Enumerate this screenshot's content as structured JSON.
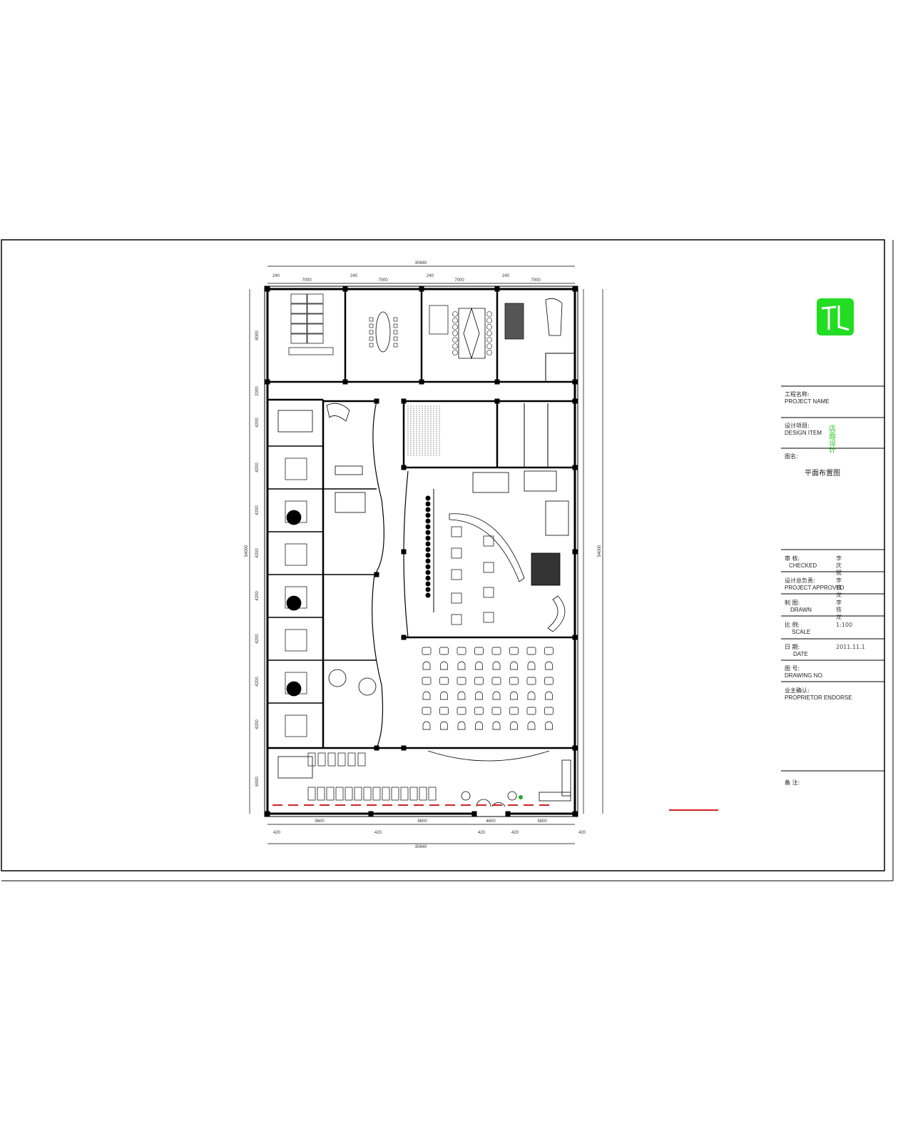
{
  "title_block": {
    "project_name": {
      "cn": "工程名称:",
      "en": "PROJECT NAME"
    },
    "design_item": {
      "cn": "设计项目:",
      "en": "DESIGN ITEM",
      "value": "店面设计"
    },
    "drawing_title": {
      "cn": "图名:",
      "value": "平面布置图"
    },
    "checked": {
      "cn": "审  核:",
      "en": "CHECKED",
      "value": "李庆斌"
    },
    "approved": {
      "cn": "设计总负责:",
      "en": "PROJECT APPROVED",
      "value": "李铁龙"
    },
    "drawn": {
      "cn": "制  图:",
      "en": "DRAWN",
      "value": "李铁龙"
    },
    "scale": {
      "cn": "比  例:",
      "en": "SCALE",
      "value": "1:100"
    },
    "date": {
      "cn": "日  期:",
      "en": "DATE",
      "value": "2011.11.1"
    },
    "drawing_no": {
      "cn": "图  号:",
      "en": "DRAWING NO."
    },
    "endorse": {
      "cn": "业主确认:",
      "en": "PROPRIETOR ENDORSE"
    },
    "remarks": {
      "cn": "备  注:"
    }
  },
  "logo": {
    "text": "TL",
    "color": "#22dd22"
  },
  "dimensions": {
    "overall_width": "30840",
    "top_bays": [
      "7000",
      "7000",
      "7000",
      "7000"
    ],
    "top_offsets": [
      "240",
      "240",
      "240",
      "240"
    ],
    "bottom_bays": [
      "9600",
      "9600",
      "4600",
      "5800"
    ],
    "bottom_offsets": [
      "420",
      "420",
      "420",
      "420",
      "420"
    ],
    "overall_height": "54000",
    "left_rooms": [
      "8000",
      "2000",
      "4200",
      "4200",
      "4200",
      "4200",
      "4200",
      "4200",
      "4200",
      "4200",
      "6000"
    ]
  },
  "colors": {
    "lines": "#000000",
    "accent_red": "#cc2222",
    "plant_green": "#22aa22"
  }
}
